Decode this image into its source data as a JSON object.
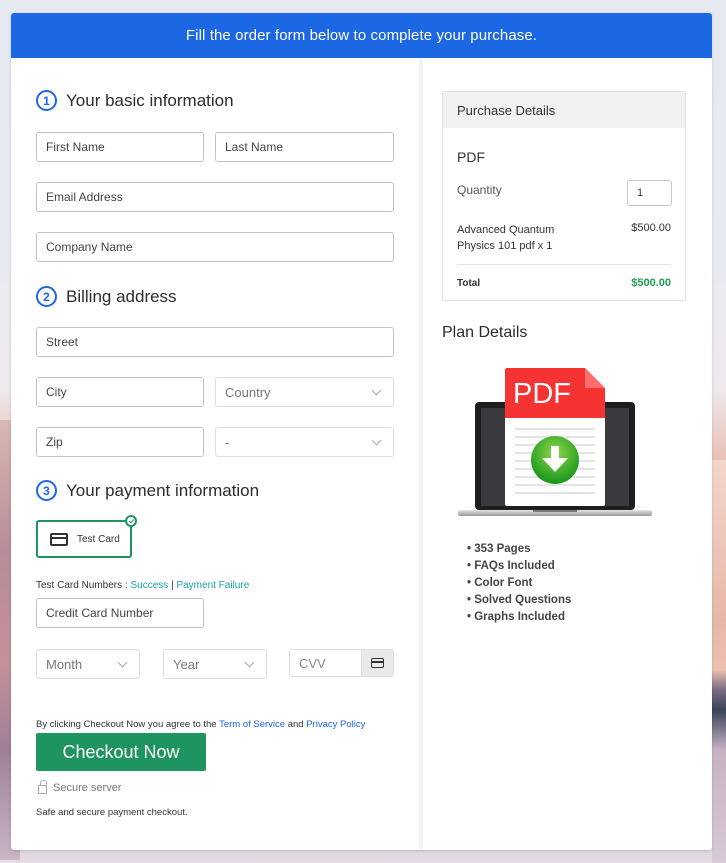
{
  "banner": {
    "text": "Fill the order form below to complete your purchase."
  },
  "sections": {
    "basic": {
      "num": "1",
      "title": "Your basic information"
    },
    "billing": {
      "num": "2",
      "title": "Billing address"
    },
    "payment": {
      "num": "3",
      "title": "Your payment information"
    }
  },
  "fields": {
    "first_name": {
      "placeholder": "First Name",
      "value": ""
    },
    "last_name": {
      "placeholder": "Last Name",
      "value": ""
    },
    "email": {
      "placeholder": "Email Address",
      "value": ""
    },
    "company": {
      "placeholder": "Company Name",
      "value": ""
    },
    "street": {
      "placeholder": "Street",
      "value": ""
    },
    "city": {
      "placeholder": "City",
      "value": ""
    },
    "country": {
      "selected": "Country"
    },
    "zip": {
      "placeholder": "Zip",
      "value": ""
    },
    "state": {
      "selected": "-"
    },
    "card_number": {
      "placeholder": "Credit Card Number",
      "value": ""
    },
    "month": {
      "selected": "Month"
    },
    "year": {
      "selected": "Year"
    },
    "cvv": {
      "placeholder": "CVV",
      "value": ""
    }
  },
  "payment": {
    "method_label": "Test Card",
    "method_selected": true,
    "test_numbers_label": "Test Card Numbers :",
    "success_link": "Success",
    "separator": "|",
    "failure_link": "Payment Failure"
  },
  "agreement": {
    "prefix": "By clicking Checkout Now you agree to the",
    "tos_link": "Term of Service",
    "and": "and",
    "privacy_link": "Privacy Policy"
  },
  "checkout": {
    "button_label": "Checkout Now",
    "secure_label": "Secure server",
    "secure_note": "Safe and secure payment checkout."
  },
  "purchase": {
    "header": "Purchase Details",
    "product_type": "PDF",
    "quantity_label": "Quantity",
    "quantity": "1",
    "item_line1": "Advanced Quantum",
    "item_line2": "Physics 101 pdf x 1",
    "item_price": "$500.00",
    "total_label": "Total",
    "total_value": "$500.00"
  },
  "plan": {
    "title": "Plan Details",
    "image_label": "PDF",
    "features": [
      "353 Pages",
      "FAQs Included",
      "Color Font",
      "Solved Questions",
      "Graphs Included"
    ]
  },
  "colors": {
    "primary": "#1c67e3",
    "success": "#1e9461",
    "total_green": "#1e9e4f",
    "link_teal": "#1aa0a4"
  }
}
